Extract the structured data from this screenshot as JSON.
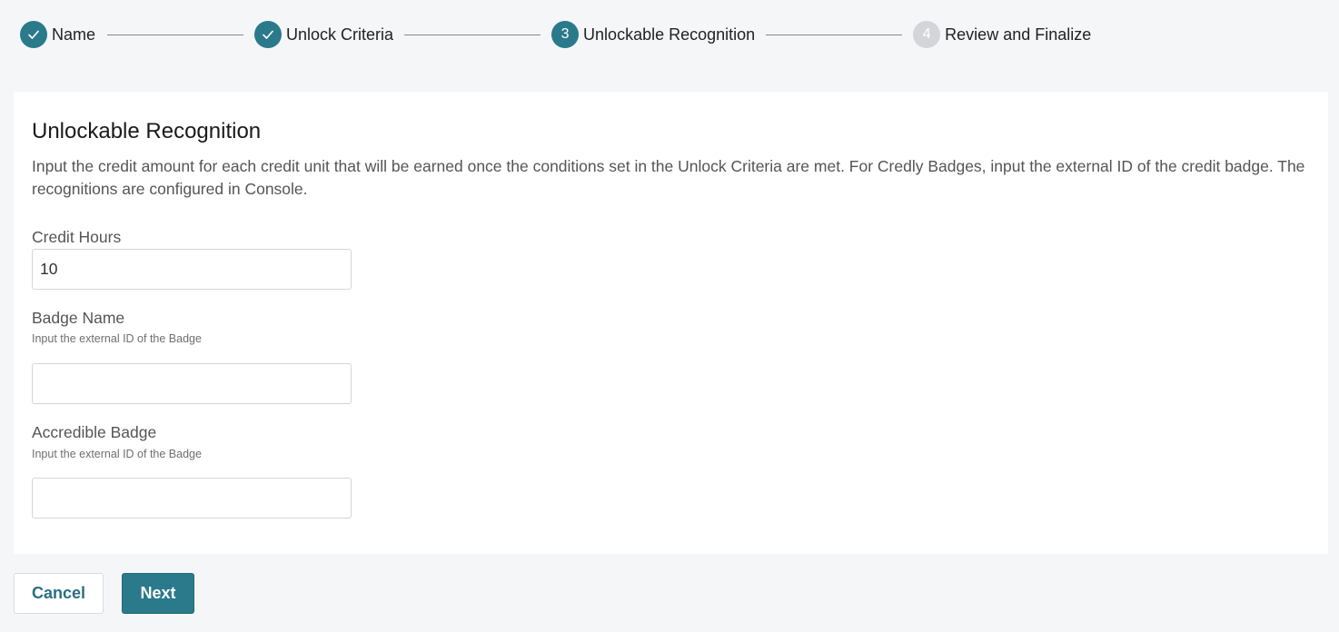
{
  "stepper": {
    "steps": [
      {
        "number": "",
        "label": "Name",
        "state": "done",
        "icon": "check-icon"
      },
      {
        "number": "",
        "label": "Unlock Criteria",
        "state": "done",
        "icon": "check-icon"
      },
      {
        "number": "3",
        "label": "Unlockable Recognition",
        "state": "active"
      },
      {
        "number": "4",
        "label": "Review and Finalize",
        "state": "pending"
      }
    ]
  },
  "section": {
    "title": "Unlockable Recognition",
    "description": "Input the credit amount for each credit unit that will be earned once the conditions set in the Unlock Criteria are met. For Credly Badges, input the external ID of the credit badge. The recognitions are configured in Console."
  },
  "fields": {
    "credit_hours": {
      "label": "Credit Hours",
      "value": "10"
    },
    "badge_name": {
      "label": "Badge Name",
      "hint": "Input the external ID of the Badge",
      "value": ""
    },
    "accredible_badge": {
      "label": "Accredible Badge",
      "hint": "Input the external ID of the Badge",
      "value": ""
    }
  },
  "actions": {
    "cancel_label": "Cancel",
    "next_label": "Next"
  },
  "colors": {
    "accent": "#2a7a8c",
    "pending": "#d3d5d8",
    "background": "#f5f6f8"
  }
}
